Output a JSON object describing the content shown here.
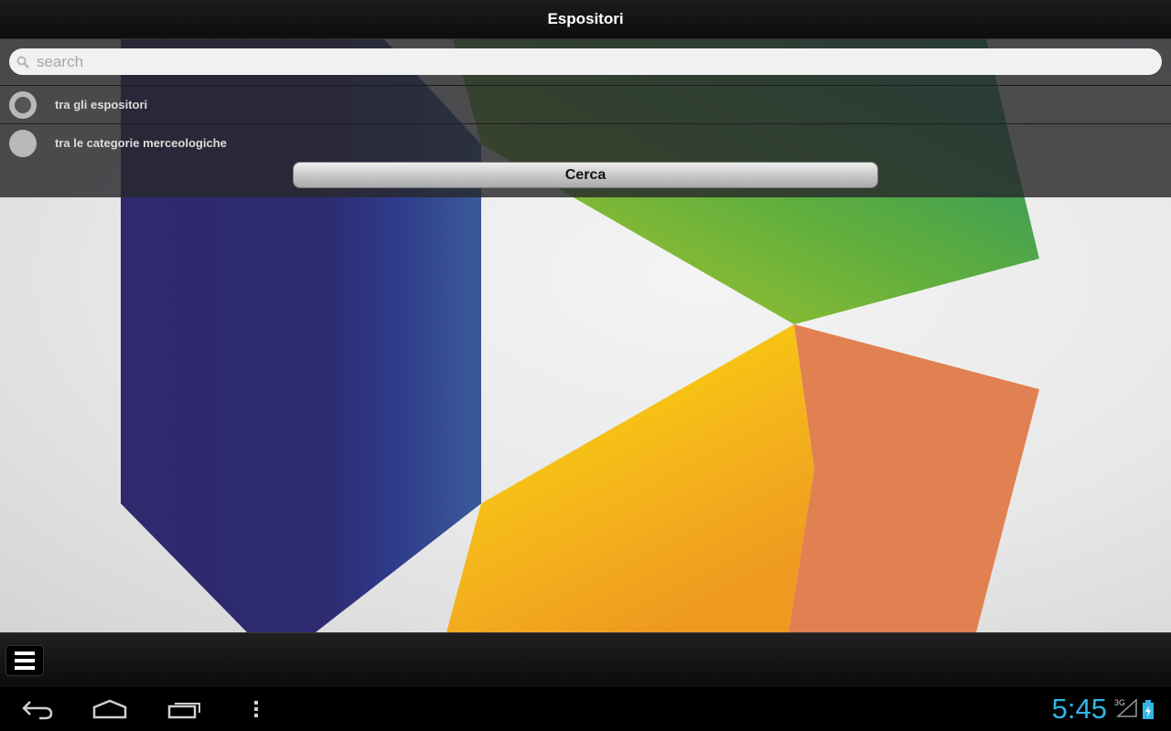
{
  "header": {
    "title": "Espositori"
  },
  "search": {
    "placeholder": "search",
    "value": ""
  },
  "options": [
    {
      "label": "tra gli espositori",
      "checked": true
    },
    {
      "label": "tra le categorie merceologiche",
      "checked": false
    }
  ],
  "actions": {
    "search_button": "Cerca"
  },
  "status": {
    "time": "5:45",
    "network": "3G"
  },
  "icons": {
    "search": "search-icon",
    "menu": "menu-icon",
    "back": "back-icon",
    "home": "home-icon",
    "recents": "recent-apps-icon",
    "overflow": "overflow-menu-icon",
    "signal": "signal-icon",
    "battery": "battery-charging-icon"
  },
  "colors": {
    "clock": "#33b5e5",
    "panel": "#28282c",
    "titlebar": "#121212"
  }
}
